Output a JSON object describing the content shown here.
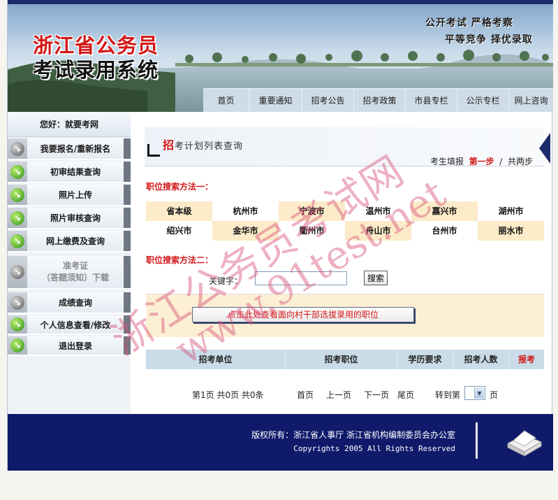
{
  "banner": {
    "title_line1": "浙江省公务员",
    "title_line2": "考试录用系统",
    "slogan1": "公开考试 严格考察",
    "slogan2": "平等竞争 择优录取"
  },
  "nav": {
    "items": [
      "首页",
      "重要通知",
      "招考公告",
      "招考政策",
      "市县专栏",
      "公示专栏",
      "网上咨询"
    ]
  },
  "sidebar": {
    "greeting": "您好：就要考网",
    "items": [
      {
        "label": "我要报名/重新报名",
        "icon": "gray-arrow-icon"
      },
      {
        "label": "初审结果查询",
        "icon": "green-arrow-icon"
      },
      {
        "label": "照片上传",
        "icon": "green-arrow-icon"
      },
      {
        "label": "照片审核查询",
        "icon": "green-arrow-icon"
      },
      {
        "label": "网上缴费及查询",
        "icon": "green-arrow-icon"
      },
      {
        "label": "准考证",
        "sublabel": "（答题须知）下载",
        "icon": "gray-arrow-icon",
        "disabled": true
      },
      {
        "label": "成绩查询",
        "icon": "gray-arrow-icon"
      },
      {
        "label": "个人信息查看/修改",
        "icon": "green-arrow-icon"
      },
      {
        "label": "退出登录",
        "icon": "green-arrow-icon"
      }
    ]
  },
  "content": {
    "title_first_char": "招",
    "title_rest": "考计划列表查询",
    "step_prefix": "考生填报",
    "step_current": "第一步",
    "step_separator": "/",
    "step_total": "共两步",
    "method1": "职位搜索方法一：",
    "method2": "职位搜索方法二：",
    "cities": [
      "省本级",
      "杭州市",
      "宁波市",
      "温州市",
      "嘉兴市",
      "湖州市",
      "绍兴市",
      "金华市",
      "衢州市",
      "舟山市",
      "台州市",
      "丽水市"
    ],
    "keyword_label": "关键字：",
    "keyword_value": "",
    "search_button": "搜索",
    "village_button": "点击此处查看面向村干部选拔录用的职位",
    "table_headers": [
      "招考单位",
      "招考职位",
      "学历要求",
      "招考人数",
      "报考"
    ],
    "pager": {
      "page_info": "第1页 共0页 共0条",
      "first": "首页",
      "prev": "上一页",
      "next": "下一页",
      "last": "尾页",
      "goto": "转到第",
      "page_unit": "页"
    }
  },
  "footer": {
    "copyright_cn": "版权所有：浙江省人事厅  浙江省机构编制委员会办公室",
    "copyright_en": "Copyrights 2005 All Rights Reserved"
  },
  "watermark": {
    "line1": "浙江公务员考试网",
    "line2": "www.91test.net"
  },
  "colors": {
    "accent_red": "#d31616",
    "footer_navy": "#0f1a6a",
    "city_highlight": "#fcebc8",
    "table_header": "#c9dce8"
  }
}
